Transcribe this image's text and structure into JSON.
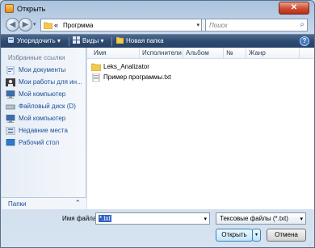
{
  "window": {
    "title": "Открыть",
    "close_glyph": "✕"
  },
  "nav": {
    "back_glyph": "◀",
    "forward_glyph": "▶",
    "history_glyph": "▾",
    "address_separator": "«",
    "address_path": "Прогрмма",
    "address_drop": "▾",
    "refresh_glyph": "↻",
    "search_placeholder": "Поиск",
    "search_icon": "⌕"
  },
  "toolbar": {
    "organize_label": "Упорядочить",
    "views_label": "Виды",
    "new_folder_label": "Новая папка",
    "drop_glyph": "▾",
    "help_glyph": "?"
  },
  "sidebar": {
    "heading": "Избранные ссылки",
    "items": [
      {
        "label": "Мои документы",
        "icon": "documents-icon"
      },
      {
        "label": "Мои работы для ин...",
        "icon": "user-icon"
      },
      {
        "label": "Мой компьютер",
        "icon": "computer-icon"
      },
      {
        "label": "Файловый диск (D)",
        "icon": "drive-icon"
      },
      {
        "label": "Мой компьютер",
        "icon": "computer-icon"
      },
      {
        "label": "Недавние места",
        "icon": "recent-icon"
      },
      {
        "label": "Рабочий стол",
        "icon": "desktop-icon"
      }
    ],
    "folders_label": "Папки",
    "folders_chevron": "⌃"
  },
  "filelist": {
    "columns": [
      "Имя",
      "Исполнители",
      "Альбом",
      "№",
      "Жанр"
    ],
    "column_drop": "▾",
    "files": [
      {
        "name": "Leks_Analizator",
        "type": "folder"
      },
      {
        "name": "Пример программы.txt",
        "type": "text"
      }
    ]
  },
  "bottom": {
    "filename_label": "Имя файла:",
    "filename_value": "*.txt",
    "filetype_value": "Тексовые файлы (*.txt)",
    "drop_glyph": "▾",
    "open_label": "Открыть",
    "cancel_label": "Отмена",
    "grip_glyph": "⋰"
  },
  "colors": {
    "toolbar": "#2f4b70",
    "link": "#1a4f98",
    "selection": "#3163c5",
    "close": "#cf4b30"
  }
}
